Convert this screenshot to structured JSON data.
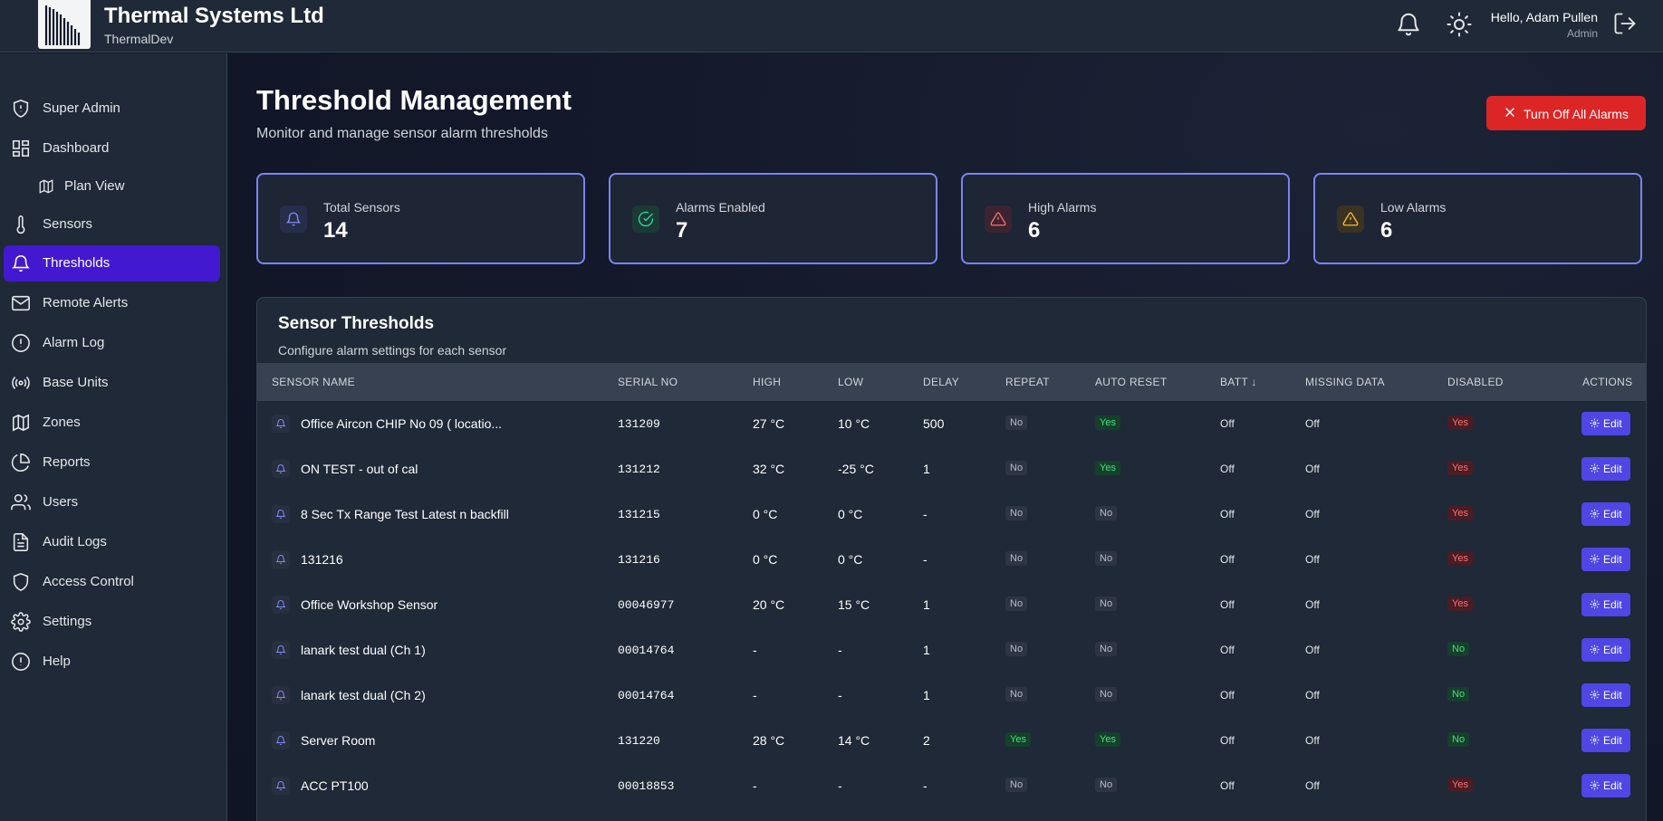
{
  "header": {
    "company_name": "Thermal Systems Ltd",
    "company_sub": "ThermalDev",
    "user_greeting": "Hello, Adam Pullen",
    "user_role": "Admin"
  },
  "sidebar": {
    "items": [
      {
        "label": "Super Admin",
        "icon": "shield-icon"
      },
      {
        "label": "Dashboard",
        "icon": "dashboard-icon"
      },
      {
        "label": "Plan View",
        "icon": "map-icon"
      },
      {
        "label": "Sensors",
        "icon": "thermometer-icon"
      },
      {
        "label": "Thresholds",
        "icon": "bell-icon"
      },
      {
        "label": "Remote Alerts",
        "icon": "mail-icon"
      },
      {
        "label": "Alarm Log",
        "icon": "alert-circle-icon"
      },
      {
        "label": "Base Units",
        "icon": "broadcast-icon"
      },
      {
        "label": "Zones",
        "icon": "map-icon"
      },
      {
        "label": "Reports",
        "icon": "pie-chart-icon"
      },
      {
        "label": "Users",
        "icon": "users-icon"
      },
      {
        "label": "Audit Logs",
        "icon": "document-icon"
      },
      {
        "label": "Access Control",
        "icon": "shield-icon"
      },
      {
        "label": "Settings",
        "icon": "gear-icon"
      },
      {
        "label": "Help",
        "icon": "help-circle-icon"
      }
    ]
  },
  "page": {
    "title": "Threshold Management",
    "subtitle": "Monitor and manage sensor alarm thresholds",
    "turn_off_label": "Turn Off All Alarms"
  },
  "stats": [
    {
      "label": "Total Sensors",
      "value": "14",
      "icon": "bell-icon",
      "color": "#818cf8"
    },
    {
      "label": "Alarms Enabled",
      "value": "7",
      "icon": "check-circle-icon",
      "color": "#34d399"
    },
    {
      "label": "High Alarms",
      "value": "6",
      "icon": "warning-icon",
      "color": "#f87171"
    },
    {
      "label": "Low Alarms",
      "value": "6",
      "icon": "warning-icon",
      "color": "#fbbf24"
    }
  ],
  "table": {
    "title": "Sensor Thresholds",
    "subtitle": "Configure alarm settings for each sensor",
    "columns": [
      "SENSOR NAME",
      "SERIAL NO",
      "HIGH",
      "LOW",
      "DELAY",
      "REPEAT",
      "AUTO RESET",
      "BATT ↓",
      "MISSING DATA",
      "DISABLED",
      "ACTIONS"
    ],
    "edit_label": "Edit",
    "rows": [
      {
        "name": "Office Aircon CHIP No 09 ( locatio...",
        "serial": "131209",
        "high": "27 °C",
        "low": "10 °C",
        "delay": "500",
        "repeat": "No",
        "auto_reset": "Yes",
        "batt": "Off",
        "missing": "Off",
        "disabled": "Yes"
      },
      {
        "name": "ON TEST - out of cal",
        "serial": "131212",
        "high": "32 °C",
        "low": "-25 °C",
        "delay": "1",
        "repeat": "No",
        "auto_reset": "Yes",
        "batt": "Off",
        "missing": "Off",
        "disabled": "Yes"
      },
      {
        "name": "8 Sec Tx Range Test Latest n backfill",
        "serial": "131215",
        "high": "0 °C",
        "low": "0 °C",
        "delay": "-",
        "repeat": "No",
        "auto_reset": "No",
        "batt": "Off",
        "missing": "Off",
        "disabled": "Yes"
      },
      {
        "name": "131216",
        "serial": "131216",
        "high": "0 °C",
        "low": "0 °C",
        "delay": "-",
        "repeat": "No",
        "auto_reset": "No",
        "batt": "Off",
        "missing": "Off",
        "disabled": "Yes"
      },
      {
        "name": "Office Workshop Sensor",
        "serial": "00046977",
        "high": "20 °C",
        "low": "15 °C",
        "delay": "1",
        "repeat": "No",
        "auto_reset": "No",
        "batt": "Off",
        "missing": "Off",
        "disabled": "Yes"
      },
      {
        "name": "lanark test dual (Ch 1)",
        "serial": "00014764",
        "high": "-",
        "low": "-",
        "delay": "1",
        "repeat": "No",
        "auto_reset": "No",
        "batt": "Off",
        "missing": "Off",
        "disabled": "No"
      },
      {
        "name": "lanark test dual (Ch 2)",
        "serial": "00014764",
        "high": "-",
        "low": "-",
        "delay": "1",
        "repeat": "No",
        "auto_reset": "No",
        "batt": "Off",
        "missing": "Off",
        "disabled": "No"
      },
      {
        "name": "Server Room",
        "serial": "131220",
        "high": "28 °C",
        "low": "14 °C",
        "delay": "2",
        "repeat": "Yes",
        "auto_reset": "Yes",
        "batt": "Off",
        "missing": "Off",
        "disabled": "No"
      },
      {
        "name": "ACC PT100",
        "serial": "00018853",
        "high": "-",
        "low": "-",
        "delay": "-",
        "repeat": "No",
        "auto_reset": "No",
        "batt": "Off",
        "missing": "Off",
        "disabled": "Yes"
      }
    ]
  }
}
